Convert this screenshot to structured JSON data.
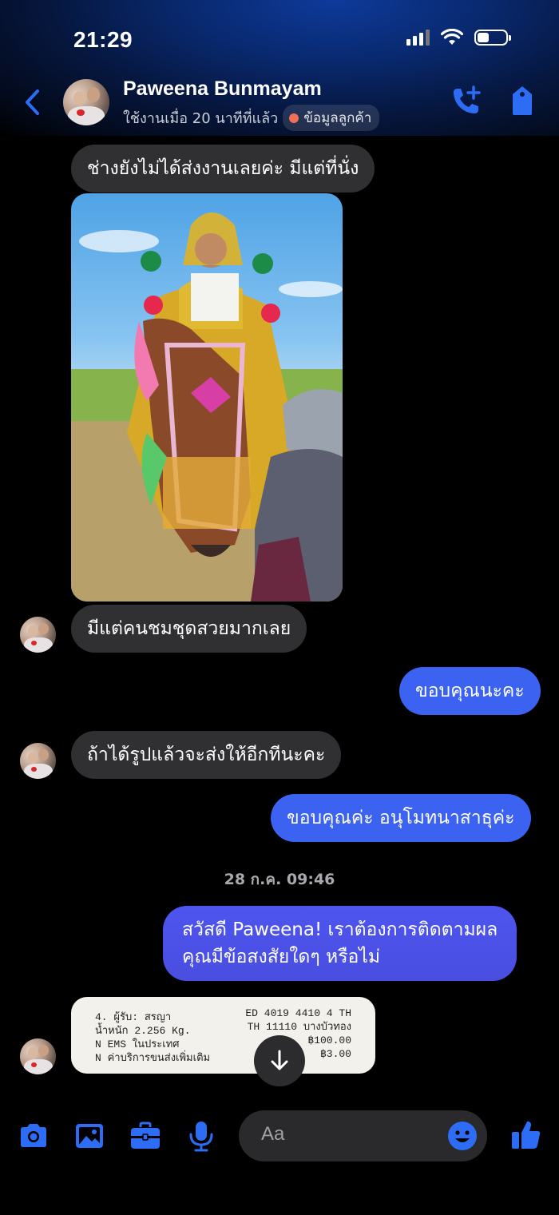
{
  "status_bar": {
    "time": "21:29"
  },
  "header": {
    "name": "Paweena Bunmayam",
    "active_text": "ใช้งานเมื่อ 20 นาทีที่แล้ว",
    "badge_label": "ข้อมูลลูกค้า",
    "icons": [
      "chevron-left-icon",
      "phone-plus-icon",
      "tag-icon"
    ],
    "accent_color": "#2d6df6"
  },
  "messages": [
    {
      "side": "in",
      "text": "ช่างยังไม่ได้ส่งงานเลยค่ะ มีแต่ที่นั่ง"
    },
    {
      "side": "in",
      "type": "photo",
      "description_icon": "photo"
    },
    {
      "side": "in",
      "text": "มีแต่คนชมชุดสวยมากเลย"
    },
    {
      "side": "out",
      "text": "ขอบคุณนะคะ"
    },
    {
      "side": "in",
      "text": "ถ้าได้รูปแล้วจะส่งให้อีกทีนะคะ"
    },
    {
      "side": "out",
      "text": "ขอบคุณค่ะ อนุโมทนาสาธุค่ะ"
    },
    {
      "side": "out",
      "lines": [
        "สวัสดี Paweena! เราต้องการติดตามผล",
        "คุณมีข้อสงสัยใดๆ หรือไม่"
      ]
    }
  ],
  "timestamp": "28 ก.ค. 09:46",
  "receipt": {
    "left_lines": [
      "4. ผู้รับ: สรญา",
      "น้ำหนัก 2.256 Kg.",
      "N EMS ในประเทศ",
      "N ค่าบริการขนส่งเพิ่มเติม"
    ],
    "right_lines": [
      "ED 4019 4410 4 TH",
      "TH 11110      บางบัวทอง",
      "฿100.00",
      "฿3.00"
    ]
  },
  "composer": {
    "placeholder": "Aa",
    "tools": [
      "camera-icon",
      "image-icon",
      "briefcase-icon",
      "microphone-icon"
    ],
    "end_icon": "thumbs-up-icon"
  },
  "colors": {
    "incoming_bubble": "#303032",
    "outgoing_bubble": "#3b62f0",
    "background": "#000000"
  }
}
